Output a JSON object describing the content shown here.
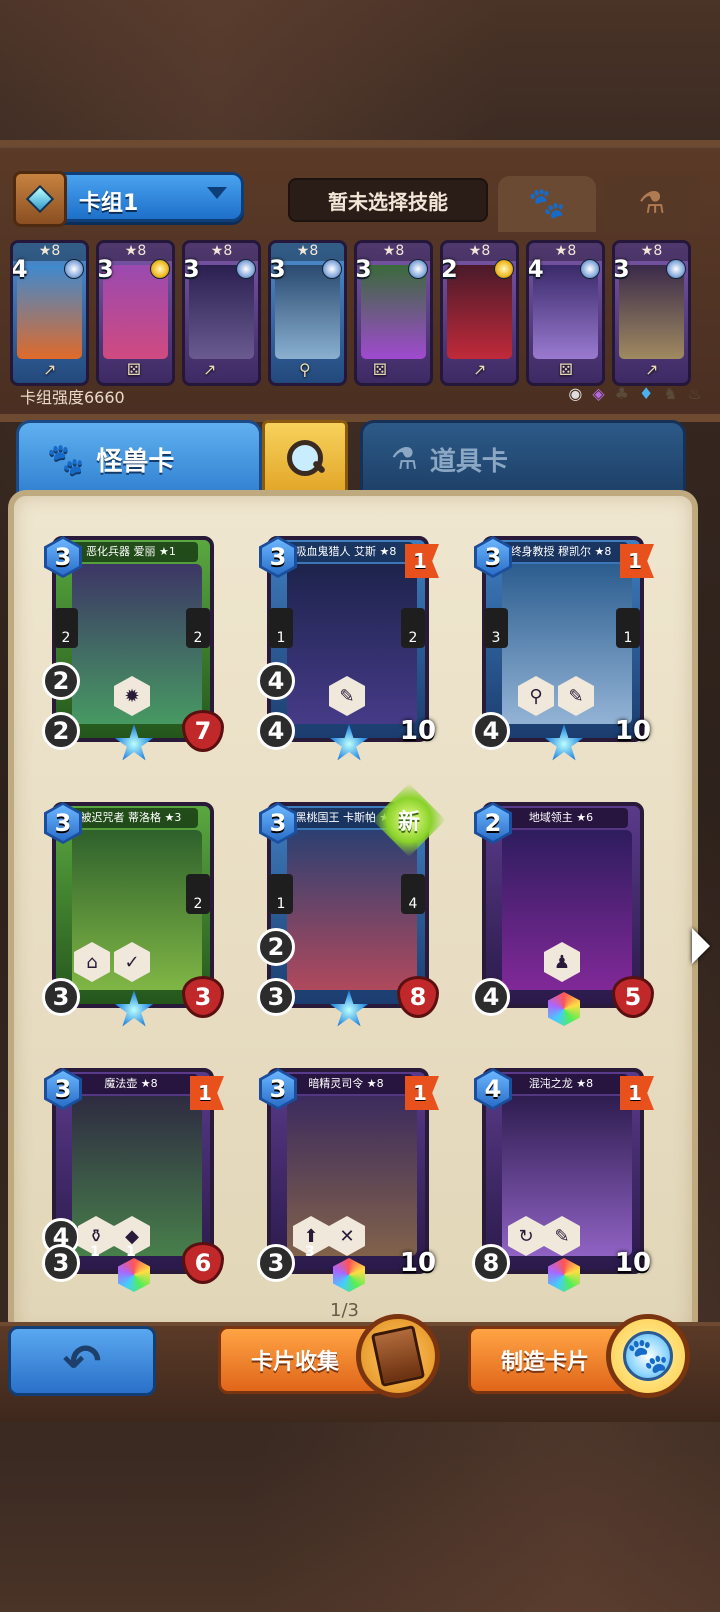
{
  "deck": {
    "name": "卡组1",
    "skill_label": "暂未选择技能",
    "power_label": "卡组强度6660"
  },
  "deck_cards": [
    {
      "level": "★8",
      "cost": "4",
      "tool": "↗"
    },
    {
      "level": "★8",
      "cost": "3",
      "tool": "⚄"
    },
    {
      "level": "★8",
      "cost": "3",
      "tool": "↗"
    },
    {
      "level": "★8",
      "cost": "3",
      "tool": "⚲"
    },
    {
      "level": "★8",
      "cost": "3",
      "tool": "⚄"
    },
    {
      "level": "★8",
      "cost": "2",
      "tool": "↗"
    },
    {
      "level": "★8",
      "cost": "4",
      "tool": "⚄"
    },
    {
      "level": "★8",
      "cost": "3",
      "tool": "↗"
    }
  ],
  "tabs": {
    "monster": "怪兽卡",
    "item": "道具卡"
  },
  "cards": [
    {
      "name": "恶化兵器 爱丽 ★1",
      "cost": "3",
      "mid": "2",
      "bot": "2",
      "hp": "7",
      "side_l": "2",
      "side_r": "2"
    },
    {
      "name": "吸血鬼猎人 艾斯 ★8",
      "cost": "3",
      "flag": "1",
      "mid": "4",
      "bot": "4",
      "hp": "10",
      "side_l": "1",
      "side_r": "2"
    },
    {
      "name": "终身教授 穆凯尔 ★8",
      "cost": "3",
      "flag": "1",
      "bot": "4",
      "hp": "10",
      "side_l": "3",
      "side_r": "1"
    },
    {
      "name": "被迟咒者 蒂洛格 ★3",
      "cost": "3",
      "bot": "3",
      "hp": "3",
      "side_r": "2"
    },
    {
      "name": "黑桃国王 卡斯帕 ★1",
      "cost": "3",
      "mid": "2",
      "bot": "3",
      "hp": "8",
      "side_l": "1",
      "side_r": "4",
      "badge": "新"
    },
    {
      "name": "地域领主 ★6",
      "cost": "2",
      "bot": "4",
      "hp": "5"
    },
    {
      "name": "魔法壶 ★8",
      "cost": "3",
      "flag": "1",
      "mid": "4",
      "bot": "3",
      "hp": "6",
      "small1": "1",
      "small2": "1"
    },
    {
      "name": "暗精灵司令 ★8",
      "cost": "3",
      "flag": "1",
      "bot": "3",
      "hp": "10",
      "small1": "3"
    },
    {
      "name": "混沌之龙 ★8",
      "cost": "4",
      "flag": "1",
      "bot": "8",
      "hp": "10"
    }
  ],
  "pager": "1/3",
  "buttons": {
    "collect": "卡片收集",
    "craft": "制造卡片"
  },
  "icons": {
    "paw": "paw-icon",
    "potion": "potion-icon",
    "search": "search-icon",
    "back": "back-arrow-icon"
  }
}
